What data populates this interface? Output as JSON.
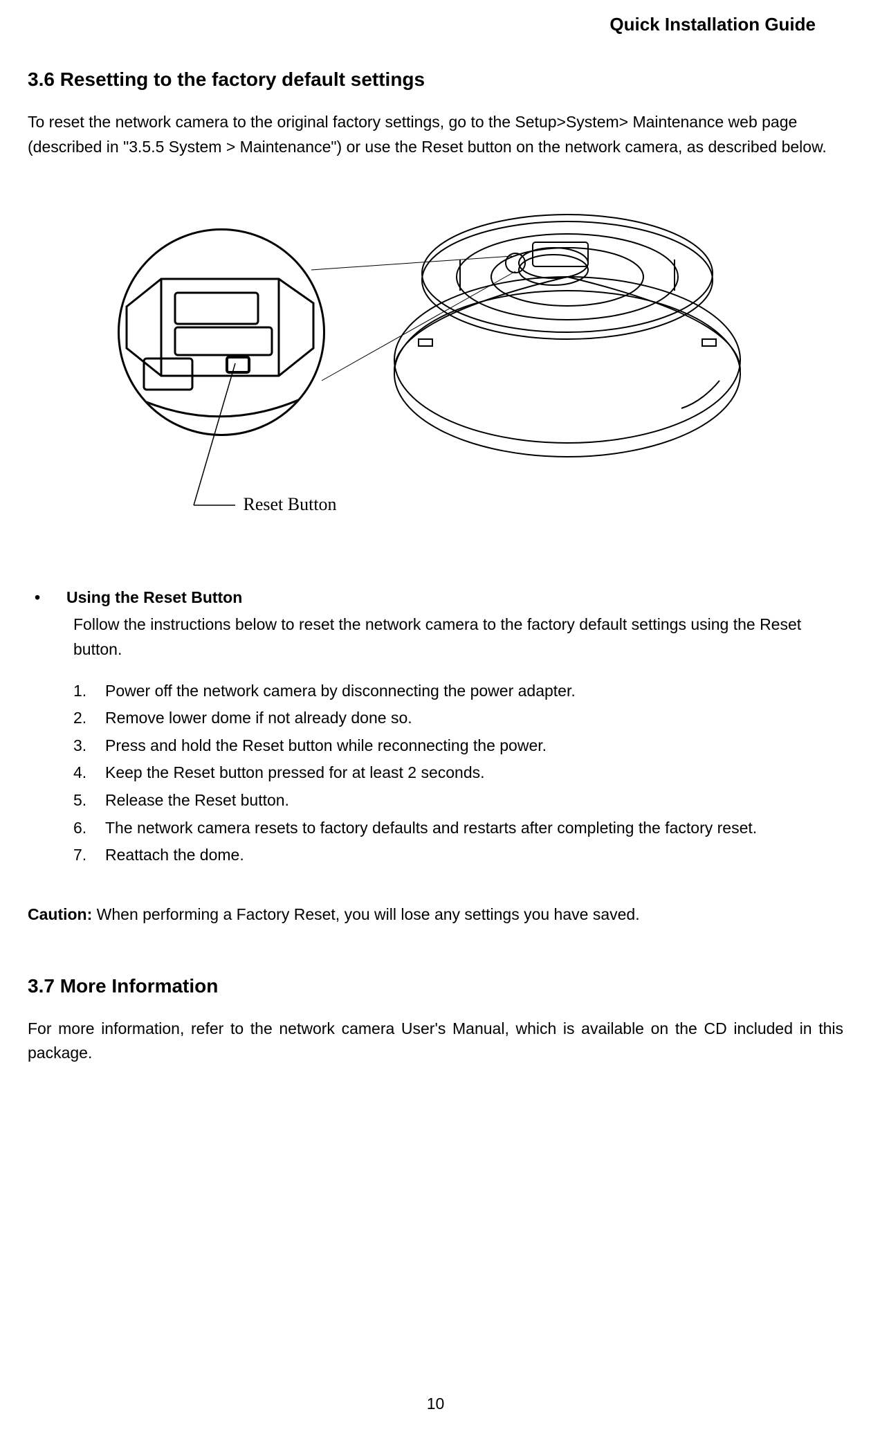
{
  "header": {
    "doc_title": "Quick Installation Guide"
  },
  "sections": {
    "s36": {
      "heading": "3.6 Resetting to the factory default settings",
      "intro": "To reset the network camera to the original factory settings, go to the Setup>System> Maintenance web page (described in \"3.5.5 System > Maintenance\") or use the Reset button on the network camera, as described below."
    },
    "figure": {
      "callout_label": "Reset Button"
    },
    "reset_instructions": {
      "bullet_title": "Using the Reset Button",
      "bullet_body": "Follow the instructions below to reset the network camera to the factory default settings using the Reset button.",
      "steps": [
        "Power off the network camera by disconnecting the power adapter.",
        "Remove lower dome if not already done so.",
        "Press and hold the Reset button while reconnecting the power.",
        "Keep the Reset button pressed for at least 2 seconds.",
        "Release the Reset button.",
        "The network camera resets to factory defaults and restarts after completing the factory reset.",
        "Reattach the dome."
      ]
    },
    "caution": {
      "label": "Caution:",
      "text": " When performing a Factory Reset, you will lose any settings you have saved."
    },
    "s37": {
      "heading": "3.7 More Information",
      "body": "For more information, refer to the network camera User's Manual, which is available on the CD included in this package."
    }
  },
  "page_number": "10"
}
